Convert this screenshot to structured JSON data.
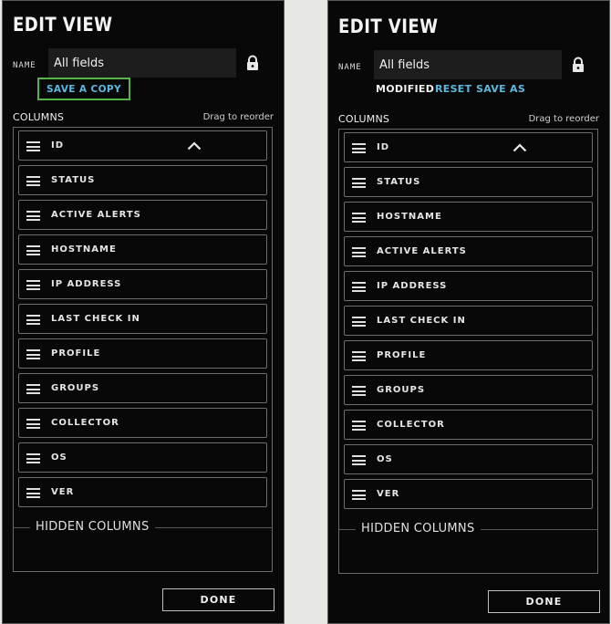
{
  "left_panel": {
    "title": "EDIT VIEW",
    "name_label": "NAME",
    "name_value": "All fields",
    "save_copy_label": "SAVE A COPY",
    "columns_label": "COLUMNS",
    "drag_hint": "Drag to reorder",
    "columns": [
      "ID",
      "STATUS",
      "ACTIVE ALERTS",
      "HOSTNAME",
      "IP ADDRESS",
      "LAST CHECK IN",
      "PROFILE",
      "GROUPS",
      "COLLECTOR",
      "OS",
      "VER"
    ],
    "hidden_columns_label": "HIDDEN COLUMNS",
    "done_label": "DONE"
  },
  "right_panel": {
    "title": "EDIT VIEW",
    "name_label": "NAME",
    "name_value": "All fields",
    "modified_label": "MODIFIED",
    "reset_label": "RESET",
    "save_as_label": "SAVE AS",
    "columns_label": "COLUMNS",
    "drag_hint": "Drag to reorder",
    "columns": [
      "ID",
      "STATUS",
      "HOSTNAME",
      "ACTIVE ALERTS",
      "IP ADDRESS",
      "LAST CHECK IN",
      "PROFILE",
      "GROUPS",
      "COLLECTOR",
      "OS",
      "VER"
    ],
    "hidden_columns_label": "HIDDEN COLUMNS",
    "done_label": "DONE"
  },
  "icons": {
    "lock": "lock-icon",
    "drag_handle": "drag-handle-icon",
    "collapse": "chevron-up-icon"
  },
  "colors": {
    "panel_bg": "#080808",
    "accent_link": "#5bb9e0",
    "focus_outline": "#56b34a",
    "page_bg": "#e6e6e3"
  }
}
